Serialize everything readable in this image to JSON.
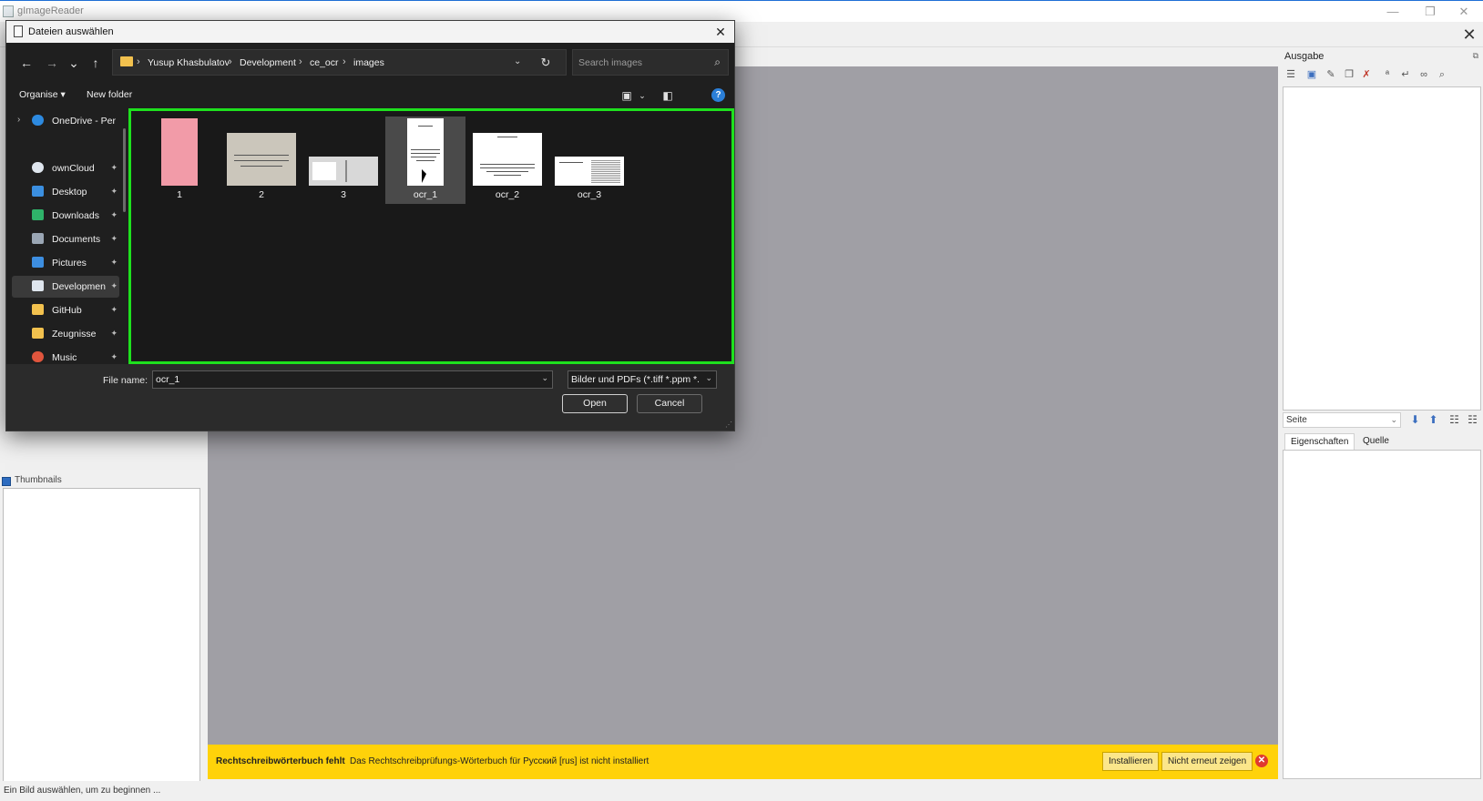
{
  "app": {
    "title": "gImageReader",
    "window_controls": {
      "minimize": "—",
      "maximize": "❐",
      "close": "✕"
    },
    "tools_icon": "✕",
    "thumbnails_label": "Thumbnails",
    "status": "Ein Bild auswählen, um zu beginnen ..."
  },
  "warning": {
    "title": "Rechtschreibwörterbuch fehlt",
    "message": "Das Rechtschreibprüfungs-Wörterbuch für Русский [rus] ist nicht installiert",
    "install_label": "Installieren",
    "dismiss_label": "Nicht erneut zeigen",
    "close_glyph": "✕"
  },
  "output_panel": {
    "title": "Ausgabe",
    "undock_glyph": "⧉",
    "page_select": "Seite",
    "tabs": [
      "Eigenschaften",
      "Quelle"
    ],
    "toolbar_icons": [
      "list-icon",
      "save-icon",
      "edit-icon",
      "copy-icon",
      "clear-icon",
      "spell-icon",
      "wrap-icon",
      "link-icon",
      "search-icon"
    ]
  },
  "dialog": {
    "title": "Dateien auswählen",
    "close_glyph": "✕",
    "nav": {
      "back": "←",
      "forward": "→",
      "recent": "⌄",
      "up": "↑"
    },
    "breadcrumb": [
      "Yusup Khasbulatov",
      "Development",
      "ce_ocr",
      "images"
    ],
    "breadcrumb_sep": "›",
    "address_dropdown": "⌄",
    "refresh_glyph": "↻",
    "search_placeholder": "Search images",
    "search_glyph": "⌕",
    "commands": {
      "organise": "Organise ▾",
      "new_folder": "New folder"
    },
    "help_glyph": "?",
    "sidebar": [
      {
        "label": "OneDrive - Perso",
        "icon": "cloud-icon",
        "color": "#2d8ae0",
        "expand": "›",
        "pinned": false
      },
      {
        "label": "ownCloud",
        "icon": "cloud-icon",
        "color": "#dfe6ee",
        "pinned": true
      },
      {
        "label": "Desktop",
        "icon": "desktop-icon",
        "color": "#3b8fe0",
        "pinned": true
      },
      {
        "label": "Downloads",
        "icon": "download-icon",
        "color": "#2fb36a",
        "pinned": true
      },
      {
        "label": "Documents",
        "icon": "documents-icon",
        "color": "#9aa6b4",
        "pinned": true
      },
      {
        "label": "Pictures",
        "icon": "pictures-icon",
        "color": "#3d8ee0",
        "pinned": true
      },
      {
        "label": "Developmen",
        "icon": "folder-icon",
        "color": "#dfe6ee",
        "pinned": true,
        "active": true
      },
      {
        "label": "GitHub",
        "icon": "folder-icon",
        "color": "#f2c14e",
        "pinned": true
      },
      {
        "label": "Zeugnisse",
        "icon": "folder-icon",
        "color": "#f2c14e",
        "pinned": true
      },
      {
        "label": "Music",
        "icon": "music-icon",
        "color": "#e0553d",
        "pinned": true
      }
    ],
    "pin_glyph": "📌",
    "files": [
      {
        "name": "1",
        "kind": "pink"
      },
      {
        "name": "2",
        "kind": "paper"
      },
      {
        "name": "3",
        "kind": "gray"
      },
      {
        "name": "ocr_1",
        "kind": "white",
        "selected": true
      },
      {
        "name": "ocr_2",
        "kind": "white"
      },
      {
        "name": "ocr_3",
        "kind": "white"
      }
    ],
    "file_name_label": "File name:",
    "file_name_value": "ocr_1",
    "file_type": "Bilder und PDFs (*.tiff *.ppm *.p",
    "open_label": "Open",
    "cancel_label": "Cancel",
    "chevron": "⌄"
  }
}
